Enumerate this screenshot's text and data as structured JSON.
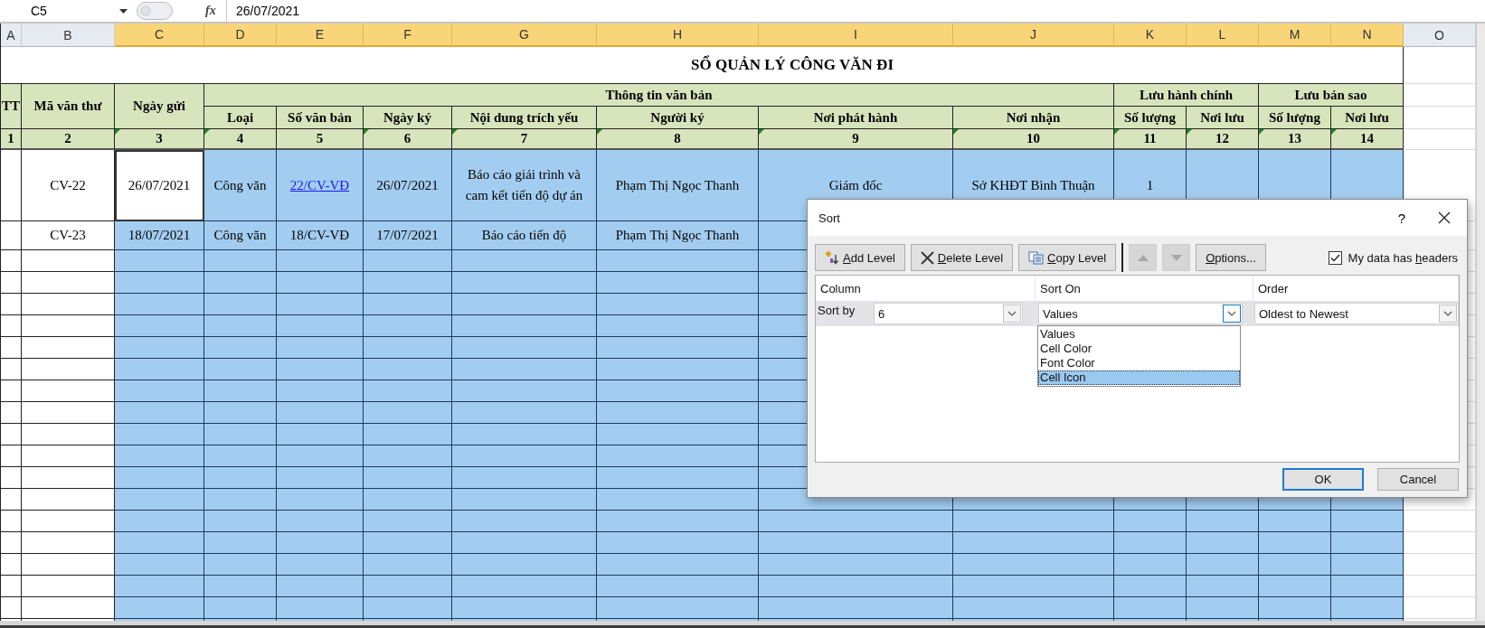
{
  "formula_bar": {
    "name_box": "C5",
    "function_label": "fx",
    "formula": "26/07/2021"
  },
  "column_headers": [
    {
      "label": "A",
      "selected": false
    },
    {
      "label": "B",
      "selected": false
    },
    {
      "label": "C",
      "selected": true
    },
    {
      "label": "D",
      "selected": true
    },
    {
      "label": "E",
      "selected": true
    },
    {
      "label": "F",
      "selected": true
    },
    {
      "label": "G",
      "selected": true
    },
    {
      "label": "H",
      "selected": true
    },
    {
      "label": "I",
      "selected": true
    },
    {
      "label": "J",
      "selected": true
    },
    {
      "label": "K",
      "selected": true
    },
    {
      "label": "L",
      "selected": true
    },
    {
      "label": "M",
      "selected": true
    },
    {
      "label": "N",
      "selected": true
    },
    {
      "label": "O",
      "selected": false
    }
  ],
  "sheet": {
    "title": "SỔ QUẢN LÝ CÔNG VĂN ĐI",
    "header": [
      {
        "label": "TT"
      },
      {
        "label": "Mã văn thư"
      },
      {
        "label": "Ngày gửi"
      },
      {
        "label": "Thông tin văn bản",
        "columns": [
          "Loại",
          "Số văn bản",
          "Ngày ký",
          "Nội dung trích yếu",
          "Người ký",
          "Nơi phát hành",
          "Nơi nhận"
        ]
      },
      {
        "label": "Lưu hành chính",
        "columns": [
          "Số lượng",
          "Nơi lưu"
        ]
      },
      {
        "label": "Lưu bản sao",
        "columns": [
          "Số lượng",
          "Nơi lưu"
        ]
      }
    ],
    "numbers": [
      {
        "label": "1",
        "flagged": false
      },
      {
        "label": "2",
        "flagged": false
      },
      {
        "label": "3",
        "flagged": true
      },
      {
        "label": "4",
        "flagged": true
      },
      {
        "label": "5",
        "flagged": false
      },
      {
        "label": "6",
        "flagged": true
      },
      {
        "label": "7",
        "flagged": true
      },
      {
        "label": "8",
        "flagged": true
      },
      {
        "label": "9",
        "flagged": true
      },
      {
        "label": "10",
        "flagged": true
      },
      {
        "label": "11",
        "flagged": true
      },
      {
        "label": "12",
        "flagged": true
      },
      {
        "label": "13",
        "flagged": true
      },
      {
        "label": "14",
        "flagged": true
      }
    ],
    "rows": [
      {
        "ma_van_thu": "CV-22",
        "ngay_gui": "26/07/2021",
        "loai": "Công văn",
        "so_van_ban": "22/CV-VĐ",
        "so_van_ban_is_link": true,
        "ngay_ky": "26/07/2021",
        "noi_dung_trich_yeu": "Báo cáo giải trình và cam kết tiến độ dự án",
        "nguoi_ky": "Phạm Thị Ngọc Thanh",
        "noi_phat_hanh": "Giám đốc",
        "noi_nhan": "Sở KHĐT Bình Thuận",
        "so_luong_hc": "1",
        "selected": true,
        "active": true
      },
      {
        "ma_van_thu": "CV-23",
        "ngay_gui": "18/07/2021",
        "loai": "Công văn",
        "so_van_ban": "18/CV-VĐ",
        "so_van_ban_is_link": false,
        "ngay_ky": "17/07/2021",
        "noi_dung_trich_yeu": "Báo cáo tiến độ",
        "nguoi_ky": "Phạm Thị Ngọc Thanh",
        "selected": true,
        "active": false
      },
      {
        "selected": true,
        "active": false
      },
      {
        "selected": true,
        "active": false
      },
      {
        "selected": true,
        "active": false
      },
      {
        "selected": true,
        "active": false
      },
      {
        "selected": true,
        "active": false
      },
      {
        "selected": true,
        "active": false
      },
      {
        "selected": true,
        "active": false
      },
      {
        "selected": true,
        "active": false
      },
      {
        "selected": true,
        "active": false
      },
      {
        "selected": true,
        "active": false
      },
      {
        "selected": true,
        "active": false
      },
      {
        "selected": true,
        "active": false
      },
      {
        "selected": true,
        "active": false
      },
      {
        "selected": true,
        "active": false
      },
      {
        "selected": true,
        "active": false
      },
      {
        "selected": true,
        "active": false
      },
      {
        "selected": true,
        "active": false
      },
      {
        "selected": true,
        "active": false
      }
    ]
  },
  "sort_dialog": {
    "title": "Sort",
    "help": "?",
    "toolbar": [
      {
        "kind": "add",
        "label": {
          "key": "A",
          "after": "dd Level"
        },
        "disabled": false
      },
      {
        "kind": "delete",
        "label": {
          "key": "D",
          "after": "elete Level"
        },
        "disabled": false
      },
      {
        "kind": "copy",
        "label": {
          "key": "C",
          "after": "opy Level"
        },
        "disabled": false
      },
      {
        "kind": "move_up",
        "disabled": true
      },
      {
        "kind": "move_down",
        "disabled": true
      },
      {
        "kind": "options",
        "label": {
          "key": "O",
          "after": "ptions..."
        },
        "disabled": false
      }
    ],
    "headers_checkbox": {
      "before": "My data has ",
      "key": "h",
      "after": "eaders",
      "checked": true
    },
    "columns": [
      "Column",
      "Sort On",
      "Order"
    ],
    "levels": [
      {
        "label": "Sort by",
        "column": "6",
        "sort_on": "Values",
        "order": "Oldest to Newest",
        "selected": true
      }
    ],
    "sort_on_list": {
      "open": true,
      "options": [
        {
          "label": "Values",
          "selected": false
        },
        {
          "label": "Cell Color",
          "selected": false
        },
        {
          "label": "Font Color",
          "selected": false
        },
        {
          "label": "Cell Icon",
          "selected": true
        }
      ]
    },
    "buttons": [
      {
        "label": "OK",
        "default": true
      },
      {
        "label": "Cancel",
        "default": false
      }
    ]
  }
}
